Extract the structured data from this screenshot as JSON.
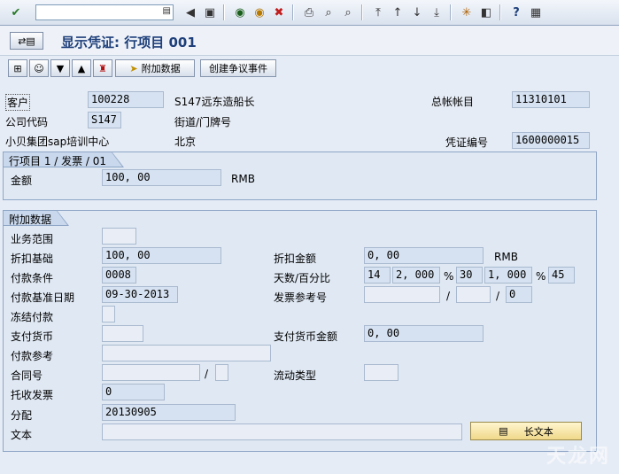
{
  "title": "显示凭证: 行项目 001",
  "app_toolbar": {
    "additional_data_label": "附加数据",
    "create_dispute_label": "创建争议事件"
  },
  "header": {
    "customer_label": "客户",
    "customer_value": "100228",
    "customer_name": "S147远东造船长",
    "gl_account_label": "总帐帐目",
    "gl_account_value": "11310101",
    "company_code_label": "公司代码",
    "company_code_value": "S147",
    "street_label": "街道/门牌号",
    "company_name": "小贝集团sap培训中心",
    "city": "北京",
    "doc_number_label": "凭证编号",
    "doc_number_value": "1600000015"
  },
  "line_item": {
    "tab_label": "行项目 1 / 发票 / 01",
    "amount_label": "金额",
    "amount_value": "100, 00",
    "currency": "RMB"
  },
  "additional": {
    "tab_label": "附加数据",
    "business_area_label": "业务范围",
    "discount_base_label": "折扣基础",
    "discount_base_value": "100, 00",
    "discount_amount_label": "折扣金额",
    "discount_amount_value": "0, 00",
    "discount_currency": "RMB",
    "payment_terms_label": "付款条件",
    "payment_terms_value": "0008",
    "days_pct_label": "天数/百分比",
    "days1": "14",
    "pct1": "2, 000",
    "days2": "30",
    "pct2": "1, 000",
    "days3": "45",
    "pct_sign": "%",
    "baseline_date_label": "付款基准日期",
    "baseline_date_value": "09-30-2013",
    "invoice_ref_label": "发票参考号",
    "slash": "/",
    "invoice_ref_item": "0",
    "payment_block_label": "冻结付款",
    "payment_currency_label": "支付货币",
    "payment_currency_amount_label": "支付货币金额",
    "payment_currency_amount_value": "0, 00",
    "payment_reference_label": "付款参考",
    "contract_label": "合同号",
    "flow_type_label": "流动类型",
    "bill_of_exchange_label": "托收发票",
    "bill_of_exchange_value": "0",
    "assignment_label": "分配",
    "assignment_value": "20130905",
    "text_label": "文本",
    "long_text_label": "长文本"
  },
  "watermark": "天龙网",
  "icons": {
    "enter": "check-icon",
    "save": "save-icon",
    "back": "back-icon",
    "exit": "exit-icon",
    "cancel": "cancel-icon",
    "print": "print-icon",
    "find": "find-icon",
    "help": "help-icon"
  }
}
